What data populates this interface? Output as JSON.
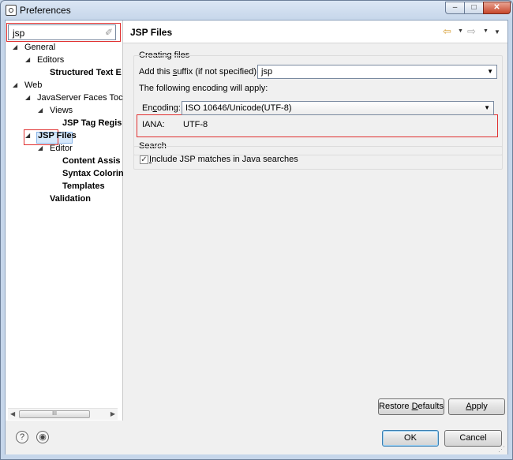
{
  "window": {
    "title": "Preferences",
    "min_label": "–",
    "max_label": "□",
    "close_label": "✕"
  },
  "filter": {
    "value": "jsp",
    "clear_icon": "✐"
  },
  "tree": {
    "general": "General",
    "editors": "Editors",
    "structured_text": "Structured Text E",
    "web": "Web",
    "jsf": "JavaServer Faces Toc",
    "views": "Views",
    "jsp_tag": "JSP Tag Regis",
    "jsp_files": "JSP Files",
    "editor": "Editor",
    "content_assist": "Content Assis",
    "syntax_coloring": "Syntax Colorin",
    "templates": "Templates",
    "validation": "Validation",
    "scroll_thumb": "III"
  },
  "page": {
    "title": "JSP Files",
    "nav_back_icon": "⇦",
    "nav_fwd_icon": "⇨",
    "dropdown_icon": "▼",
    "creating_files": {
      "label": "Creating files",
      "suffix_label_pre": "Add this ",
      "suffix_label_underline": "s",
      "suffix_label_post": "uffix (if not specified):",
      "suffix_value": "jsp",
      "encoding_note": "The following encoding will apply:",
      "encoding_label_pre": "En",
      "encoding_label_underline": "c",
      "encoding_label_post": "oding:",
      "encoding_value": "ISO 10646/Unicode(UTF-8)",
      "iana_label": "IANA:",
      "iana_value": "UTF-8"
    },
    "search": {
      "label": "Search",
      "checkbox_checked": true,
      "checkbox_mark": "✓",
      "checkbox_label_pre": "",
      "checkbox_label_underline": "I",
      "checkbox_label_post": "nclude JSP matches in Java searches"
    },
    "restore_defaults_pre": "Restore ",
    "restore_defaults_underline": "D",
    "restore_defaults_post": "efaults",
    "apply_underline": "A",
    "apply_post": "pply"
  },
  "footer": {
    "help_icon": "?",
    "import_export_icon": "◉",
    "ok_label": "OK",
    "cancel_label": "Cancel",
    "grip": "⋰"
  }
}
